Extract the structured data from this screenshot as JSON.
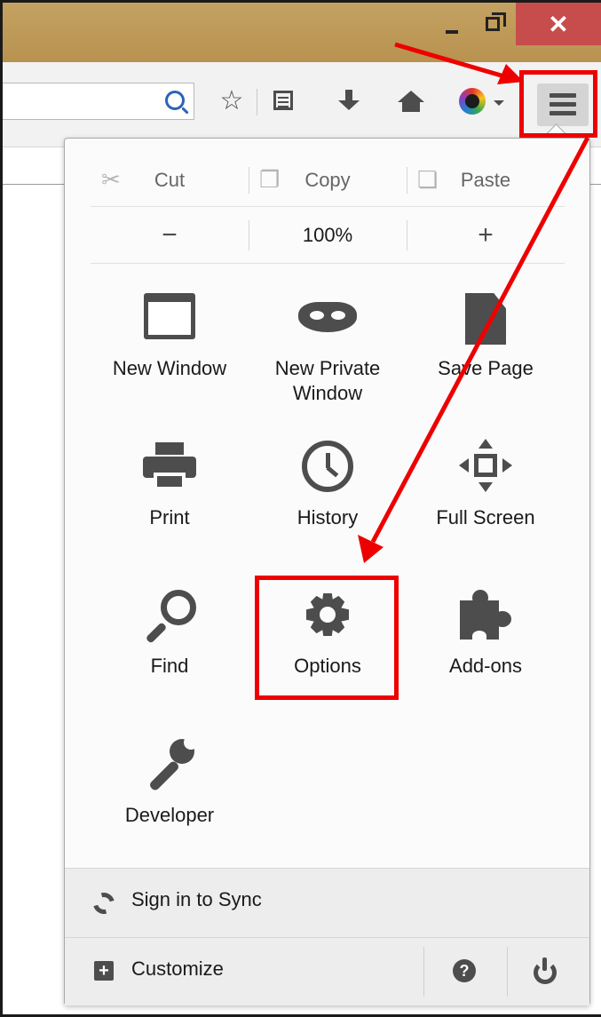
{
  "window": {
    "minimize_icon": "minimize-icon",
    "maximize_icon": "restore-icon",
    "close_glyph": "✕",
    "titlebar_color": "#c09c5d",
    "close_color": "#c74d4d"
  },
  "toolbar": {
    "search_icon": "search-icon",
    "star_glyph": "☆",
    "icons": [
      "bookmark-star-icon",
      "reading-list-icon",
      "downloads-icon",
      "home-icon",
      "persona-icon",
      "menu-icon"
    ]
  },
  "menu": {
    "edit": {
      "cut": "Cut",
      "copy": "Copy",
      "paste": "Paste",
      "cut_glyph": "✂",
      "copy_glyph": "❐",
      "paste_glyph": "❏"
    },
    "zoom": {
      "minus": "−",
      "level": "100%",
      "plus": "+"
    },
    "items": {
      "new_window": "New Window",
      "new_private_window_line1": "New Private",
      "new_private_window_line2": "Window",
      "save_page": "Save Page",
      "print": "Print",
      "history": "History",
      "full_screen": "Full Screen",
      "find": "Find",
      "options": "Options",
      "addons": "Add-ons",
      "developer": "Developer"
    },
    "footer": {
      "sign_in": "Sign in to Sync",
      "customize": "Customize",
      "customize_glyph": "+",
      "help_glyph": "?"
    }
  },
  "annotation": {
    "highlight_color": "#ee0000"
  }
}
